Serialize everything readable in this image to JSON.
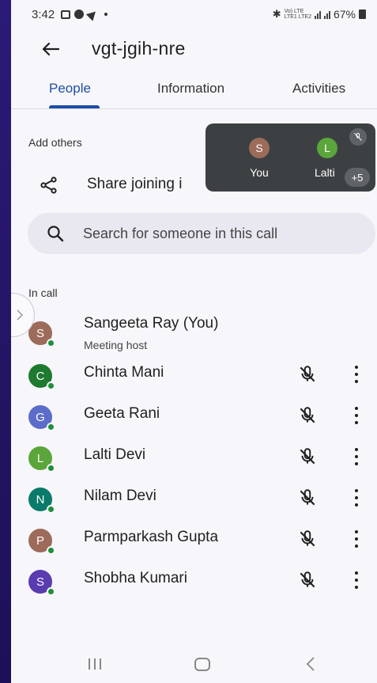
{
  "status_bar": {
    "time": "3:42",
    "network_label_top": "Vo) LTE",
    "network_label_bottom": "LTE1 LTE2",
    "battery": "67%"
  },
  "header": {
    "title": "vgt-jgih-nre"
  },
  "tabs": [
    {
      "label": "People",
      "active": true
    },
    {
      "label": "Information",
      "active": false
    },
    {
      "label": "Activities",
      "active": false
    }
  ],
  "add_others": {
    "heading": "Add others",
    "share_label": "Share joining i"
  },
  "search": {
    "placeholder": "Search for someone in this call"
  },
  "in_call": {
    "heading": "In call",
    "participants": [
      {
        "initial": "S",
        "name": "Sangeeta Ray (You)",
        "subtitle": "Meeting host",
        "color": "#9c6b5a",
        "muted": false
      },
      {
        "initial": "C",
        "name": "Chinta Mani",
        "color": "#1e7a2e",
        "muted": true
      },
      {
        "initial": "G",
        "name": "Geeta Rani",
        "color": "#5b6cc9",
        "muted": true
      },
      {
        "initial": "L",
        "name": "Lalti Devi",
        "color": "#5aa63a",
        "muted": true
      },
      {
        "initial": "N",
        "name": "Nilam Devi",
        "color": "#0a7a6a",
        "muted": true
      },
      {
        "initial": "P",
        "name": "Parmparkash Gupta",
        "color": "#9c6b5a",
        "muted": true
      },
      {
        "initial": "S",
        "name": "Shobha Kumari",
        "color": "#5a3bb0",
        "muted": true
      }
    ]
  },
  "pip": {
    "tiles": [
      {
        "initial": "S",
        "name": "You",
        "color": "#9c6b5a"
      },
      {
        "initial": "L",
        "name": "Lalti",
        "color": "#5aa63a"
      }
    ],
    "more_count": "+5"
  },
  "colors": {
    "accent": "#1c4fa6",
    "online": "#1f8f3a",
    "background": "#f7f6fa"
  }
}
